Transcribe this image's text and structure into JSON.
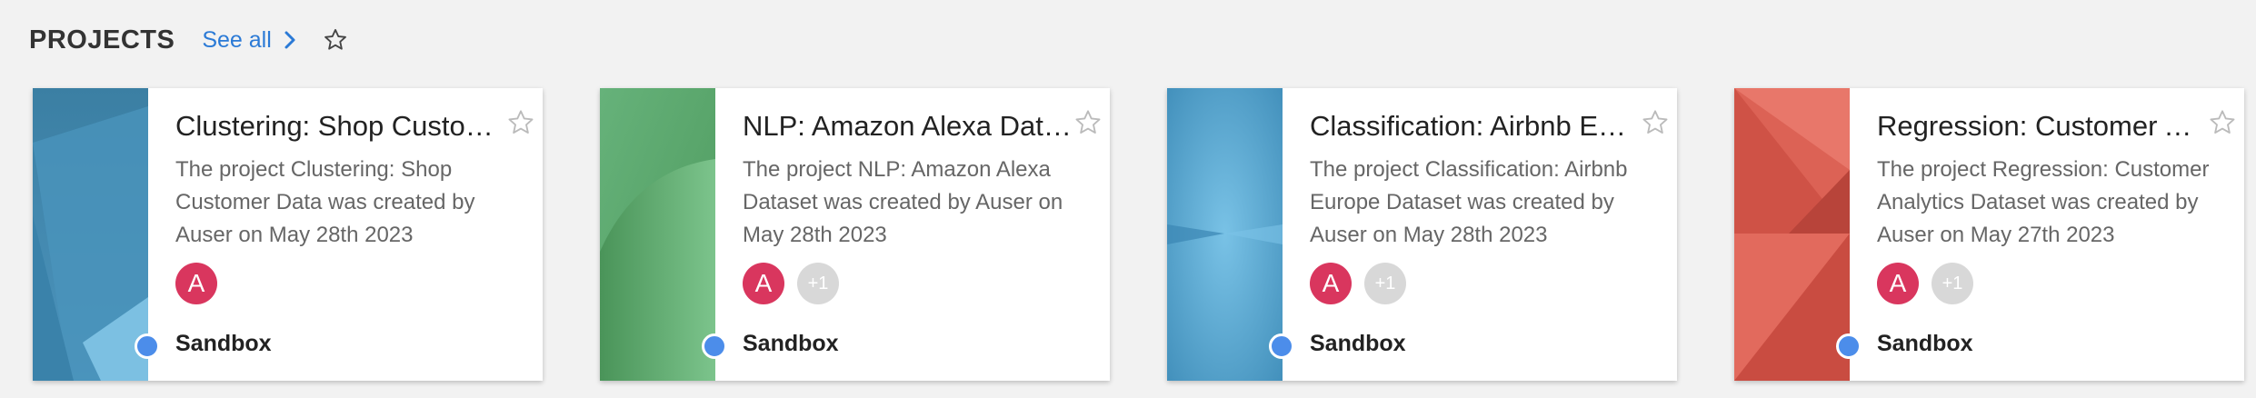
{
  "header": {
    "title": "PROJECTS",
    "see_all_label": "See all",
    "icons": [
      "chevron-right-icon",
      "star-outline-icon"
    ]
  },
  "colors": {
    "link": "#2b7ad6",
    "avatar": "#d9365e",
    "status_dot": "#4c8dea",
    "card_blue": "#4a91b8",
    "card_green": "#5aa86a",
    "card_red": "#db5e52"
  },
  "cards": [
    {
      "title": "Clustering: Shop Customer Data",
      "description": "The project Clustering: Shop Customer Data was created by Auser on May 28th 2023",
      "avatar_letter": "A",
      "extra_members": "",
      "type": "Sandbox",
      "thumbnail": "blue-geometric"
    },
    {
      "title": "NLP: Amazon Alexa Dataset",
      "description": "The project NLP: Amazon Alexa Dataset was created by Auser on May 28th 2023",
      "avatar_letter": "A",
      "extra_members": "+1",
      "type": "Sandbox",
      "thumbnail": "green-arc"
    },
    {
      "title": "Classification: Airbnb Europe Dataset",
      "description": "The project Classification: Airbnb Europe Dataset was created by Auser on May 28th 2023",
      "avatar_letter": "A",
      "extra_members": "+1",
      "type": "Sandbox",
      "thumbnail": "blue-radial"
    },
    {
      "title": "Regression: Customer Analytics Dataset",
      "description": "The project Regression: Customer Analytics Dataset was created by Auser on May 27th 2023",
      "avatar_letter": "A",
      "extra_members": "+1",
      "type": "Sandbox",
      "thumbnail": "red-triangles"
    }
  ]
}
